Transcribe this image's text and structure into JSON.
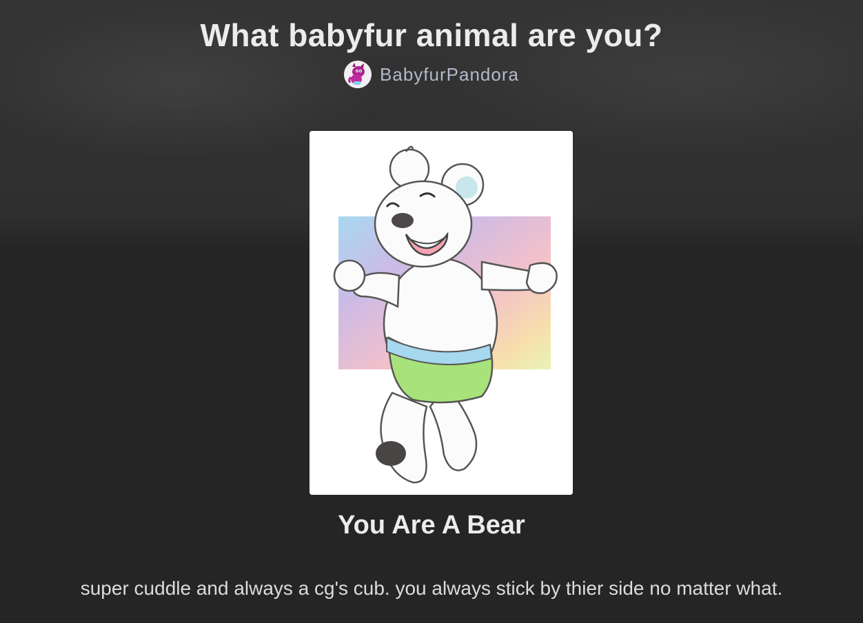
{
  "quiz": {
    "title": "What babyfur animal are you?",
    "author": {
      "name": "BabyfurPandora",
      "avatar_icon": "purple-dragon-avatar"
    }
  },
  "result": {
    "image_subject": "white bear cub in green diaper on rainbow background",
    "title": "You Are A Bear",
    "description": "super cuddle and always a cg's cub. you always stick by thier side no matter what."
  },
  "colors": {
    "background": "#252525",
    "title_text": "#ececec",
    "author_text": "#b4b9c9",
    "description_text": "#dcdcdc"
  }
}
